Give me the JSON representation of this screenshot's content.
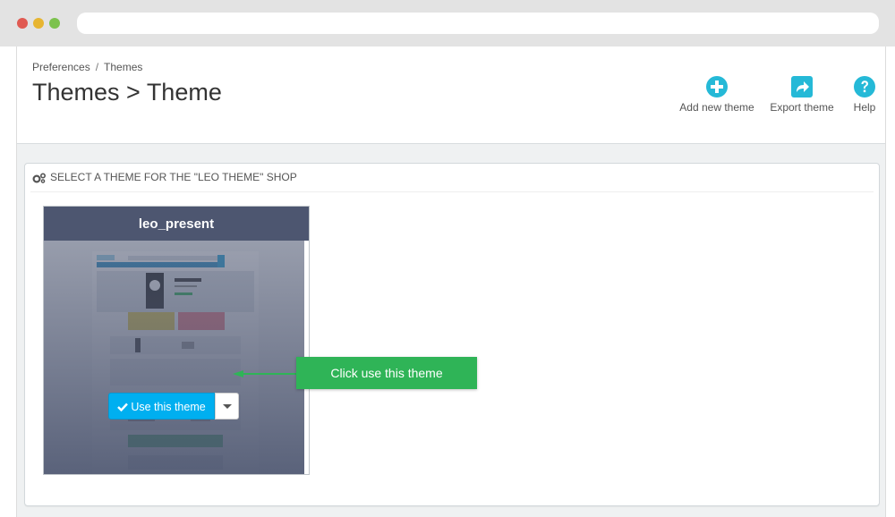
{
  "browser": {
    "address": ""
  },
  "breadcrumb": {
    "parent": "Preferences",
    "separator": "/",
    "current": "Themes"
  },
  "page_title": "Themes > Theme",
  "toolbar": {
    "add_label": "Add new theme",
    "export_label": "Export theme",
    "help_label": "Help",
    "icon_color": "#25b9d7"
  },
  "panel": {
    "heading": "SELECT A THEME FOR THE \"LEO THEME\" SHOP"
  },
  "theme_card": {
    "name": "leo_present",
    "header_color": "#4d5670",
    "use_label": "Use this theme",
    "use_color": "#00aff0"
  },
  "callout": {
    "text": "Click use this theme",
    "color": "#2fb457"
  },
  "icons": [
    "plus-circle-icon",
    "share-icon",
    "question-icon",
    "cogs-icon",
    "check-icon",
    "caret-down-icon",
    "arrow-left-icon"
  ]
}
